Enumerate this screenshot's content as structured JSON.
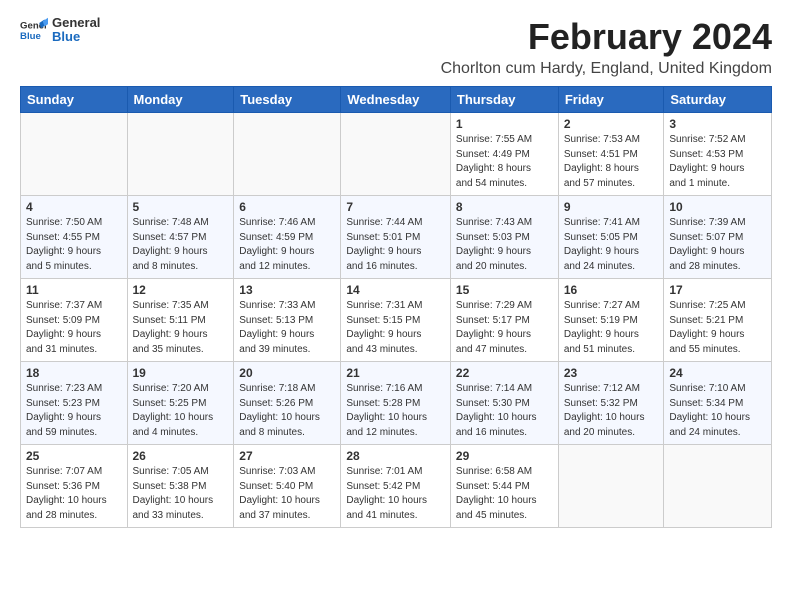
{
  "logo": {
    "line1": "General",
    "line2": "Blue"
  },
  "title": "February 2024",
  "subtitle": "Chorlton cum Hardy, England, United Kingdom",
  "days_of_week": [
    "Sunday",
    "Monday",
    "Tuesday",
    "Wednesday",
    "Thursday",
    "Friday",
    "Saturday"
  ],
  "weeks": [
    [
      {
        "day": "",
        "info": ""
      },
      {
        "day": "",
        "info": ""
      },
      {
        "day": "",
        "info": ""
      },
      {
        "day": "",
        "info": ""
      },
      {
        "day": "1",
        "info": "Sunrise: 7:55 AM\nSunset: 4:49 PM\nDaylight: 8 hours\nand 54 minutes."
      },
      {
        "day": "2",
        "info": "Sunrise: 7:53 AM\nSunset: 4:51 PM\nDaylight: 8 hours\nand 57 minutes."
      },
      {
        "day": "3",
        "info": "Sunrise: 7:52 AM\nSunset: 4:53 PM\nDaylight: 9 hours\nand 1 minute."
      }
    ],
    [
      {
        "day": "4",
        "info": "Sunrise: 7:50 AM\nSunset: 4:55 PM\nDaylight: 9 hours\nand 5 minutes."
      },
      {
        "day": "5",
        "info": "Sunrise: 7:48 AM\nSunset: 4:57 PM\nDaylight: 9 hours\nand 8 minutes."
      },
      {
        "day": "6",
        "info": "Sunrise: 7:46 AM\nSunset: 4:59 PM\nDaylight: 9 hours\nand 12 minutes."
      },
      {
        "day": "7",
        "info": "Sunrise: 7:44 AM\nSunset: 5:01 PM\nDaylight: 9 hours\nand 16 minutes."
      },
      {
        "day": "8",
        "info": "Sunrise: 7:43 AM\nSunset: 5:03 PM\nDaylight: 9 hours\nand 20 minutes."
      },
      {
        "day": "9",
        "info": "Sunrise: 7:41 AM\nSunset: 5:05 PM\nDaylight: 9 hours\nand 24 minutes."
      },
      {
        "day": "10",
        "info": "Sunrise: 7:39 AM\nSunset: 5:07 PM\nDaylight: 9 hours\nand 28 minutes."
      }
    ],
    [
      {
        "day": "11",
        "info": "Sunrise: 7:37 AM\nSunset: 5:09 PM\nDaylight: 9 hours\nand 31 minutes."
      },
      {
        "day": "12",
        "info": "Sunrise: 7:35 AM\nSunset: 5:11 PM\nDaylight: 9 hours\nand 35 minutes."
      },
      {
        "day": "13",
        "info": "Sunrise: 7:33 AM\nSunset: 5:13 PM\nDaylight: 9 hours\nand 39 minutes."
      },
      {
        "day": "14",
        "info": "Sunrise: 7:31 AM\nSunset: 5:15 PM\nDaylight: 9 hours\nand 43 minutes."
      },
      {
        "day": "15",
        "info": "Sunrise: 7:29 AM\nSunset: 5:17 PM\nDaylight: 9 hours\nand 47 minutes."
      },
      {
        "day": "16",
        "info": "Sunrise: 7:27 AM\nSunset: 5:19 PM\nDaylight: 9 hours\nand 51 minutes."
      },
      {
        "day": "17",
        "info": "Sunrise: 7:25 AM\nSunset: 5:21 PM\nDaylight: 9 hours\nand 55 minutes."
      }
    ],
    [
      {
        "day": "18",
        "info": "Sunrise: 7:23 AM\nSunset: 5:23 PM\nDaylight: 9 hours\nand 59 minutes."
      },
      {
        "day": "19",
        "info": "Sunrise: 7:20 AM\nSunset: 5:25 PM\nDaylight: 10 hours\nand 4 minutes."
      },
      {
        "day": "20",
        "info": "Sunrise: 7:18 AM\nSunset: 5:26 PM\nDaylight: 10 hours\nand 8 minutes."
      },
      {
        "day": "21",
        "info": "Sunrise: 7:16 AM\nSunset: 5:28 PM\nDaylight: 10 hours\nand 12 minutes."
      },
      {
        "day": "22",
        "info": "Sunrise: 7:14 AM\nSunset: 5:30 PM\nDaylight: 10 hours\nand 16 minutes."
      },
      {
        "day": "23",
        "info": "Sunrise: 7:12 AM\nSunset: 5:32 PM\nDaylight: 10 hours\nand 20 minutes."
      },
      {
        "day": "24",
        "info": "Sunrise: 7:10 AM\nSunset: 5:34 PM\nDaylight: 10 hours\nand 24 minutes."
      }
    ],
    [
      {
        "day": "25",
        "info": "Sunrise: 7:07 AM\nSunset: 5:36 PM\nDaylight: 10 hours\nand 28 minutes."
      },
      {
        "day": "26",
        "info": "Sunrise: 7:05 AM\nSunset: 5:38 PM\nDaylight: 10 hours\nand 33 minutes."
      },
      {
        "day": "27",
        "info": "Sunrise: 7:03 AM\nSunset: 5:40 PM\nDaylight: 10 hours\nand 37 minutes."
      },
      {
        "day": "28",
        "info": "Sunrise: 7:01 AM\nSunset: 5:42 PM\nDaylight: 10 hours\nand 41 minutes."
      },
      {
        "day": "29",
        "info": "Sunrise: 6:58 AM\nSunset: 5:44 PM\nDaylight: 10 hours\nand 45 minutes."
      },
      {
        "day": "",
        "info": ""
      },
      {
        "day": "",
        "info": ""
      }
    ]
  ]
}
